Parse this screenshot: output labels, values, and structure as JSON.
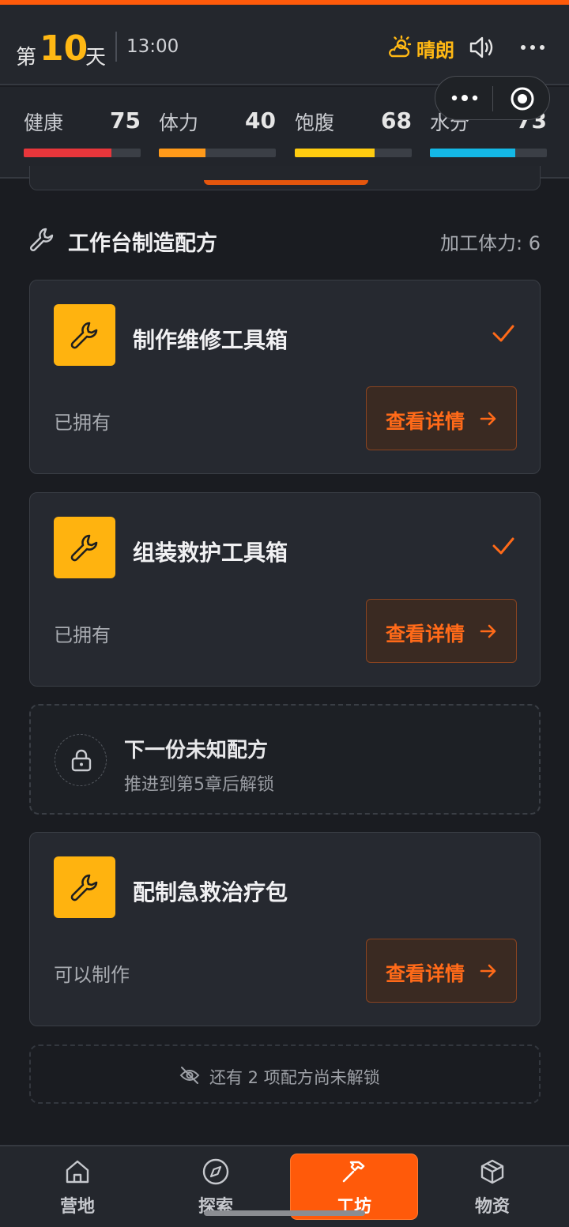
{
  "header": {
    "day_prefix": "第",
    "day_number": "10",
    "day_suffix": "天",
    "time": "13:00",
    "weather": "晴朗",
    "colors": {
      "accent": "#ff5a0a",
      "highlight": "#ffb814"
    }
  },
  "stats": [
    {
      "label": "健康",
      "value": "75",
      "level": 0.75,
      "color": "#e8363b"
    },
    {
      "label": "体力",
      "value": "40",
      "level": 0.4,
      "color": "#ff9a1a"
    },
    {
      "label": "饱腹",
      "value": "68",
      "level": 0.68,
      "color": "#ffcc10"
    },
    {
      "label": "水分",
      "value": "73",
      "level": 0.73,
      "color": "#14b8e6"
    }
  ],
  "section": {
    "title": "工作台制造配方",
    "meta": "加工体力: 6"
  },
  "recipes": [
    {
      "title": "制作维修工具箱",
      "status": "已拥有",
      "owned": true,
      "button": "查看详情"
    },
    {
      "title": "组装救护工具箱",
      "status": "已拥有",
      "owned": true,
      "button": "查看详情"
    },
    {
      "title": "配制急救治疗包",
      "status": "可以制作",
      "owned": false,
      "button": "查看详情"
    }
  ],
  "locked": {
    "title": "下一份未知配方",
    "hint": "推进到第5章后解锁"
  },
  "more_note": "还有 2 项配方尚未解锁",
  "nav": [
    {
      "label": "营地",
      "icon": "home-icon",
      "active": false
    },
    {
      "label": "探索",
      "icon": "compass-icon",
      "active": false
    },
    {
      "label": "工坊",
      "icon": "hammer-icon",
      "active": true
    },
    {
      "label": "物资",
      "icon": "box-icon",
      "active": false
    }
  ]
}
